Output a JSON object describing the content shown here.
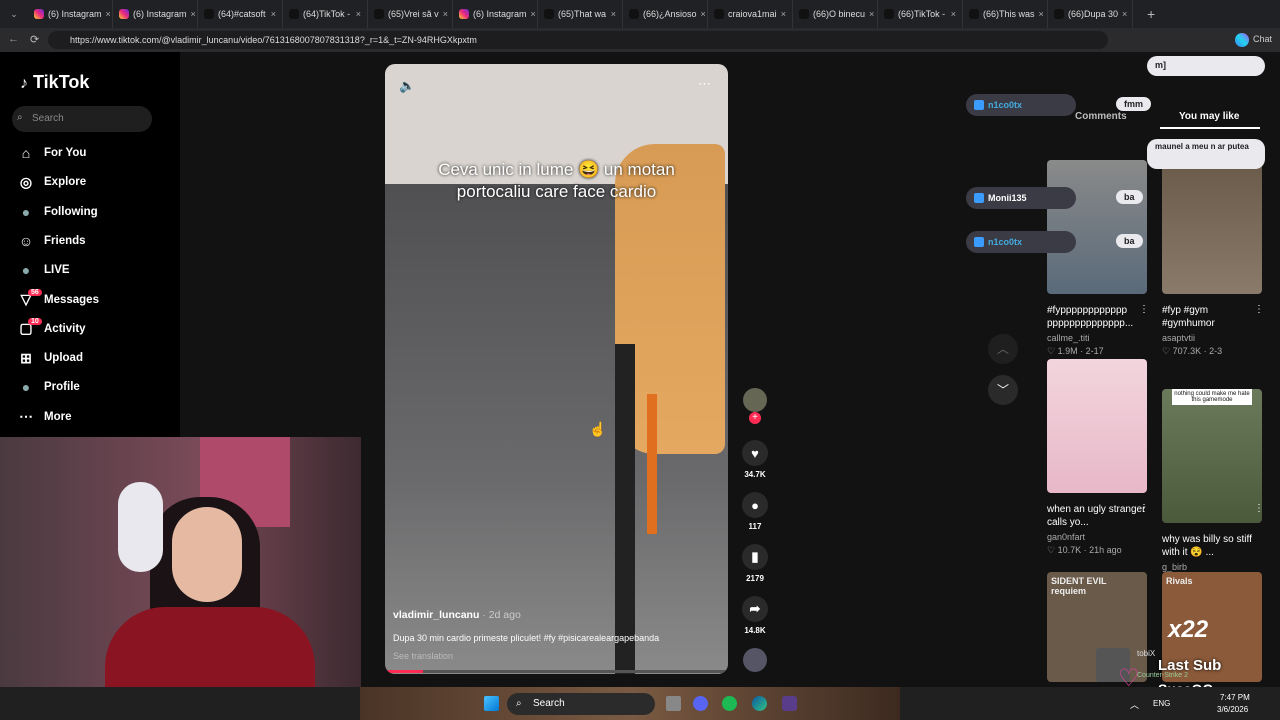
{
  "browser": {
    "tabs": [
      {
        "label": "(6) Instagram",
        "icon": "instagram-icon"
      },
      {
        "label": "(6) Instagram",
        "icon": "instagram-icon"
      },
      {
        "label": "(64)#catsoft",
        "icon": "tiktok-icon"
      },
      {
        "label": "(64)TikTok -",
        "icon": "tiktok-icon"
      },
      {
        "label": "(65)Vrei să v",
        "icon": "tiktok-icon"
      },
      {
        "label": "(6) Instagram",
        "icon": "instagram-icon"
      },
      {
        "label": "(65)That wa",
        "icon": "tiktok-icon"
      },
      {
        "label": "(66)¿Ansioso",
        "icon": "tiktok-icon"
      },
      {
        "label": "craiova1mai",
        "icon": "tiktok-icon"
      },
      {
        "label": "(66)O binecu",
        "icon": "tiktok-icon"
      },
      {
        "label": "(66)TikTok -",
        "icon": "tiktok-icon"
      },
      {
        "label": "(66)This was",
        "icon": "tiktok-icon"
      },
      {
        "label": "(66)Dupa 30",
        "icon": "tiktok-icon"
      }
    ],
    "url": "https://www.tiktok.com/@vladimir_luncanu/video/7613168007807831318?_r=1&_t=ZN-94RHGXkpxtm",
    "chat_label": "Chat"
  },
  "sidebar": {
    "logo": "TikTok",
    "search_placeholder": "Search",
    "items": [
      {
        "label": "For You",
        "icon": "home-icon"
      },
      {
        "label": "Explore",
        "icon": "compass-icon"
      },
      {
        "label": "Following",
        "icon": "following-avatar-icon"
      },
      {
        "label": "Friends",
        "icon": "friends-icon"
      },
      {
        "label": "LIVE",
        "icon": "live-avatar-icon"
      },
      {
        "label": "Messages",
        "icon": "messages-icon",
        "badge": "56"
      },
      {
        "label": "Activity",
        "icon": "activity-icon",
        "badge": "10"
      },
      {
        "label": "Upload",
        "icon": "upload-icon"
      },
      {
        "label": "Profile",
        "icon": "profile-avatar-icon"
      },
      {
        "label": "More",
        "icon": "more-icon"
      }
    ]
  },
  "video": {
    "caption_overlay": "Ceva unic in lume 😆 un motan portocaliu care face cardio",
    "author": "vladimir_luncanu",
    "posted": "· 2d ago",
    "description": "Dupa 30 min cardio primeste pliculet! #fy #pisicarealeargapebanda",
    "see_translation": "See translation",
    "progress_fraction": 0.11
  },
  "actions": {
    "likes": "34.7K",
    "comments": "117",
    "saves": "2179",
    "shares": "14.8K"
  },
  "right_panel": {
    "tabs": [
      "Comments",
      "You may like"
    ],
    "cards": [
      {
        "title": "#fypppppppppppp pppppppppppppp...",
        "user": "callme_.titi",
        "likes": "1.9M",
        "date": "2-17"
      },
      {
        "title": "#fyp #gym #gymhumor",
        "user": "asaptvtii",
        "likes": "707.3K",
        "date": "2-3"
      },
      {
        "title": "when an ugly stranger calls yo...",
        "user": "gan0nfart",
        "likes": "10.7K",
        "date": "21h ago"
      },
      {
        "title": "why was billy so stiff with it 😵 ...",
        "user": "g_birb",
        "likes": "4491",
        "date": "4d ago"
      }
    ],
    "thumb_caption": "nothing could make me hate this gamemode",
    "bottom_thumbs": [
      "SIDENT EVIL requiem",
      "Rivals"
    ]
  },
  "stream_overlay": {
    "chat": [
      {
        "user": "n1co0tx",
        "msg": "fmm"
      },
      {
        "user": "Monii135",
        "msg": "ba"
      },
      {
        "user": "n1co0tx",
        "msg": "ba"
      }
    ],
    "bubbles": [
      "m]",
      "maunel a meu n ar putea"
    ],
    "last_sub_title": "Last Sub",
    "last_sub_name": "SusaOG",
    "tobix_line": "tobiX",
    "game_line": "Counter-Strike 2",
    "x22": "x22"
  },
  "taskbar": {
    "search": "Search",
    "lang": "ENG",
    "time": "7:47 PM",
    "date": "3/6/2026"
  },
  "colors": {
    "accent": "#fe2c55",
    "bg": "#121212"
  }
}
